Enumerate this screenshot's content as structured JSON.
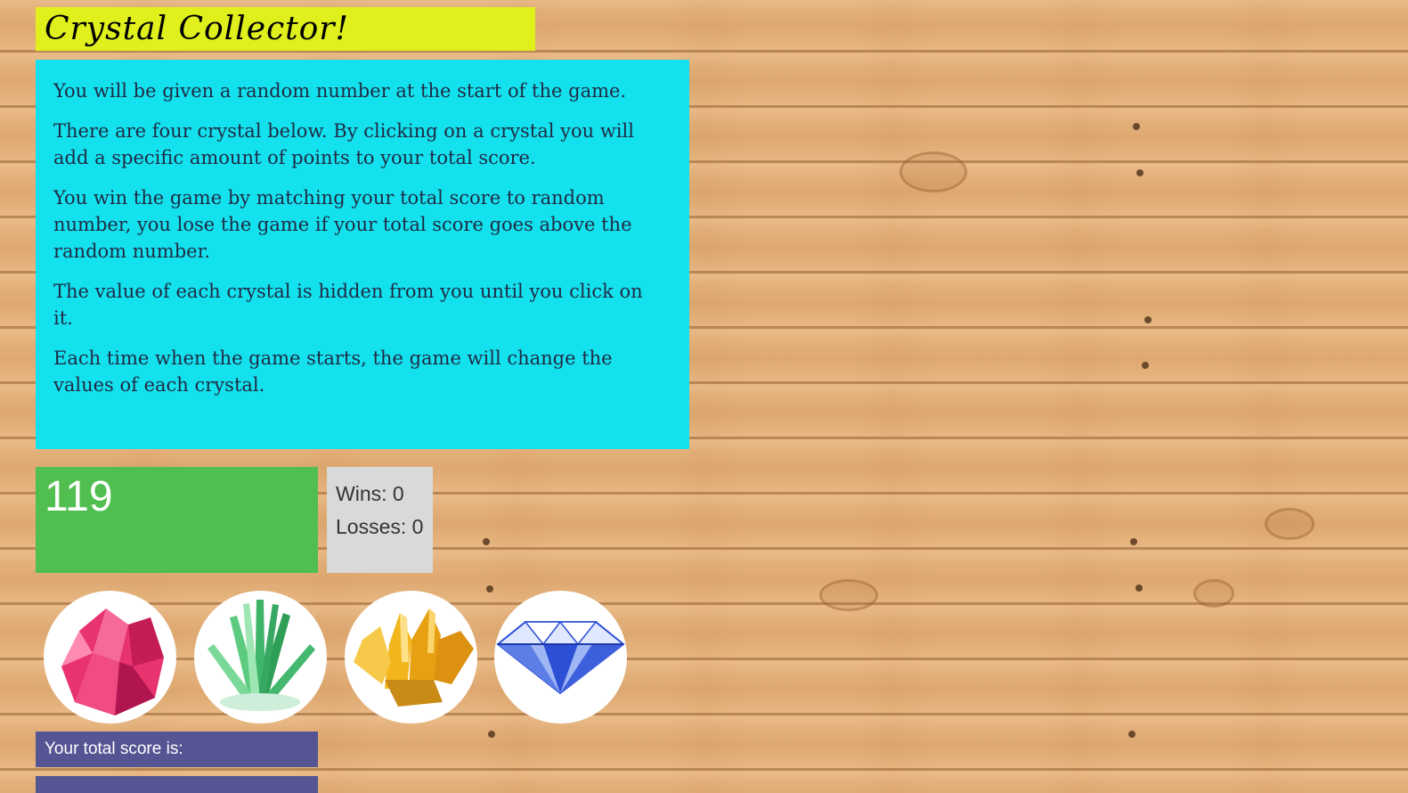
{
  "game": {
    "title": "Crystal Collector!",
    "instructions": [
      "You will be given a random number at the start of the game.",
      "There are four crystal below. By clicking on a crystal you will add a specific amount of points to your total score.",
      "You win the game by matching your total score to random number, you lose the game if your total score goes above the random number.",
      "The value of each crystal is hidden from you until you click on it.",
      "Each time when the game starts, the game will change the values of each crystal."
    ],
    "random_number": "119",
    "wins_label": "Wins: 0",
    "losses_label": "Losses: 0",
    "total_score_label": "Your total score is:",
    "total_score_value": "",
    "crystals": [
      {
        "name": "pink-crystal",
        "color": "#e8336f"
      },
      {
        "name": "green-crystal",
        "color": "#3fb56a"
      },
      {
        "name": "yellow-crystal",
        "color": "#f2b61c"
      },
      {
        "name": "blue-diamond",
        "color": "#2d4fd6"
      }
    ]
  },
  "colors": {
    "title_bg": "#dff01c",
    "instructions_bg": "#14e1ee",
    "random_number_bg": "#51bf50",
    "stats_bg": "#d9d9d9",
    "score_bar_bg": "#565593"
  }
}
